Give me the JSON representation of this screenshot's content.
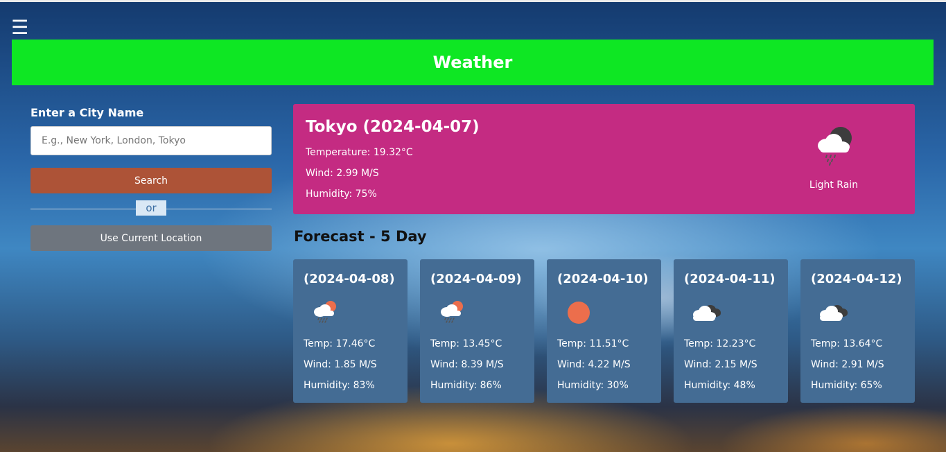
{
  "header": {
    "title": "Weather",
    "menu_icon": "hamburger-icon"
  },
  "search": {
    "label": "Enter a City Name",
    "placeholder": "E.g., New York, London, Tokyo",
    "value": "",
    "search_button": "Search",
    "or_text": "or",
    "location_button": "Use Current Location"
  },
  "current": {
    "title": "Tokyo (2024-04-07)",
    "temperature": "Temperature: 19.32°C",
    "wind": "Wind: 2.99 M/S",
    "humidity": "Humidity: 75%",
    "icon": "rain-cloud-night-icon",
    "description": "Light Rain"
  },
  "forecast": {
    "heading": "Forecast - 5 Day",
    "days": [
      {
        "date": "(2024-04-08)",
        "icon": "rain-cloud-sun-icon",
        "temp": "Temp: 17.46°C",
        "wind": "Wind: 1.85 M/S",
        "humidity": "Humidity: 83%"
      },
      {
        "date": "(2024-04-09)",
        "icon": "rain-cloud-sun-icon",
        "temp": "Temp: 13.45°C",
        "wind": "Wind: 8.39 M/S",
        "humidity": "Humidity: 86%"
      },
      {
        "date": "(2024-04-10)",
        "icon": "sun-icon",
        "temp": "Temp: 11.51°C",
        "wind": "Wind: 4.22 M/S",
        "humidity": "Humidity: 30%"
      },
      {
        "date": "(2024-04-11)",
        "icon": "broken-clouds-icon",
        "temp": "Temp: 12.23°C",
        "wind": "Wind: 2.15 M/S",
        "humidity": "Humidity: 48%"
      },
      {
        "date": "(2024-04-12)",
        "icon": "broken-clouds-icon",
        "temp": "Temp: 13.64°C",
        "wind": "Wind: 2.91 M/S",
        "humidity": "Humidity: 65%"
      }
    ]
  },
  "colors": {
    "header_bg": "#0ee723",
    "current_card_bg": "#c42b82",
    "forecast_card_bg": "#446c94",
    "search_button_bg": "#ad5337",
    "location_button_bg": "#6e757e"
  }
}
